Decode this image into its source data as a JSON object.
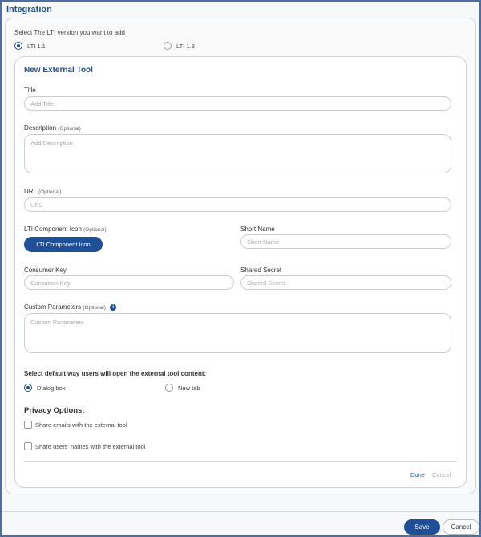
{
  "window": {
    "title": "Integration"
  },
  "version": {
    "prompt": "Select The LTI version you want to add",
    "options": [
      {
        "label": "LTI 1.1",
        "selected": true
      },
      {
        "label": "LTI 1.3",
        "selected": false
      }
    ]
  },
  "form": {
    "card_title": "New External Tool",
    "title_label": "Title",
    "title_placeholder": "Add Title",
    "description_label": "Description",
    "optional": "(Optional)",
    "description_placeholder": "Add Description",
    "url_label": "URL",
    "url_placeholder": "URL",
    "icon_label": "LTI Component Icon",
    "icon_button": "LTI Component Icon",
    "short_name_label": "Short Name",
    "short_name_placeholder": "Short Name",
    "consumer_key_label": "Consumer Key",
    "consumer_key_placeholder": "Consumer Key",
    "shared_secret_label": "Shared Secret",
    "shared_secret_placeholder": "Shared Secret",
    "custom_params_label": "Custom Parameters",
    "custom_params_placeholder": "Custom Parameters",
    "open_mode_label": "Select default way users will open the external tool content:",
    "open_modes": [
      {
        "label": "Dialog box",
        "selected": true
      },
      {
        "label": "New tab",
        "selected": false
      }
    ],
    "privacy_title": "Privacy Options:",
    "privacy_options": [
      {
        "label": "Share emails with the external tool",
        "checked": false
      },
      {
        "label": "Share users' names with the external tool",
        "checked": false
      }
    ],
    "done_label": "Done",
    "cancel_label": "Cancel"
  },
  "footer": {
    "save_label": "Save",
    "cancel_label": "Cancel"
  },
  "colors": {
    "accent": "#1f4f96",
    "title": "#1d4f91"
  },
  "icons": {
    "info": "info-icon"
  }
}
